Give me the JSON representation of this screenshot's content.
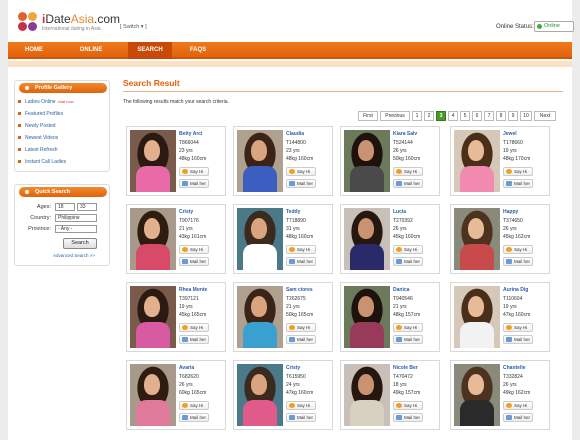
{
  "header": {
    "brand_prefix": "i",
    "brand_main": "Date",
    "brand_accent": "Asia",
    "brand_suffix": ".com",
    "tagline": "International dating in Asia",
    "switch_label": "[ Switch ▾ ]",
    "status_label": "Online Status:",
    "status_value": "Online"
  },
  "nav": {
    "items": [
      {
        "label": "HOME"
      },
      {
        "label": "ONLINE"
      },
      {
        "label": "SEARCH"
      },
      {
        "label": "FAQS"
      }
    ]
  },
  "sidebar": {
    "profile_gallery": {
      "title": "Profile Gallery",
      "items": [
        {
          "label": "Ladies Online",
          "badge": "chat now"
        },
        {
          "label": "Featured Profiles"
        },
        {
          "label": "Newly Posted"
        },
        {
          "label": "Newest Videos"
        },
        {
          "label": "Latest Refresh"
        },
        {
          "label": "Instant Call Ladies"
        }
      ]
    },
    "quick_search": {
      "title": "Quick Search",
      "ages_label": "Ages:",
      "age_from": "18",
      "age_to": "33",
      "country_label": "Country:",
      "country_value": "Philippine",
      "province_label": "Province:",
      "province_value": "- Any -",
      "search_button": "Search",
      "advanced_link": "Advanced Search >>"
    }
  },
  "main": {
    "title": "Search Result",
    "subtitle": "The following results match your search criteria.",
    "pager": [
      "First",
      "Previous",
      "1",
      "2",
      "3",
      "4",
      "5",
      "6",
      "7",
      "8",
      "9",
      "10",
      "Next"
    ],
    "active_page": "3",
    "say_hi_label": "Say Hi",
    "mail_label": "Mail her",
    "profiles": [
      {
        "name": "Betty Arci",
        "id": "T866044",
        "age": "23 yrs",
        "stats": "48kg 160cm"
      },
      {
        "name": "Claudia",
        "id": "T144800",
        "age": "23 yrs",
        "stats": "48kg 160cm"
      },
      {
        "name": "Kiara Salv",
        "id": "T524144",
        "age": "26 yrs",
        "stats": "50kg 160cm"
      },
      {
        "name": "Jewel",
        "id": "T178660",
        "age": "19 yrs",
        "stats": "48kg 170cm"
      },
      {
        "name": "Cristy",
        "id": "T907176",
        "age": "21 yrs",
        "stats": "43kg 161cm"
      },
      {
        "name": "Teddy",
        "id": "T718890",
        "age": "31 yrs",
        "stats": "48kg 160cm"
      },
      {
        "name": "Lucia",
        "id": "T270392",
        "age": "26 yrs",
        "stats": "45kg 160cm"
      },
      {
        "name": "Happy",
        "id": "T374650",
        "age": "26 yrs",
        "stats": "45kg 162cm"
      },
      {
        "name": "Rhea Monte",
        "id": "T397121",
        "age": "19 yrs",
        "stats": "45kg 165cm"
      },
      {
        "name": "Sam ciores",
        "id": "T262675",
        "age": "21 yrs",
        "stats": "50kg 165cm"
      },
      {
        "name": "Danica",
        "id": "T940546",
        "age": "21 yrs",
        "stats": "48kg 157cm"
      },
      {
        "name": "Aurina Dig",
        "id": "T110604",
        "age": "19 yrs",
        "stats": "47kg 160cm"
      },
      {
        "name": "Avaria",
        "id": "T682620",
        "age": "26 yrs",
        "stats": "60kg 165cm"
      },
      {
        "name": "Cristy",
        "id": "T615950",
        "age": "24 yrs",
        "stats": "47kg 160cm"
      },
      {
        "name": "Nicole Ber",
        "id": "T470472",
        "age": "18 yrs",
        "stats": "49kg 157cm"
      },
      {
        "name": "Chantelle",
        "id": "T332824",
        "age": "26 yrs",
        "stats": "49kg 162cm"
      }
    ]
  },
  "colors": {
    "accent": "#e0620c",
    "link": "#2a5ea8",
    "active_page": "#4a9a2a"
  }
}
